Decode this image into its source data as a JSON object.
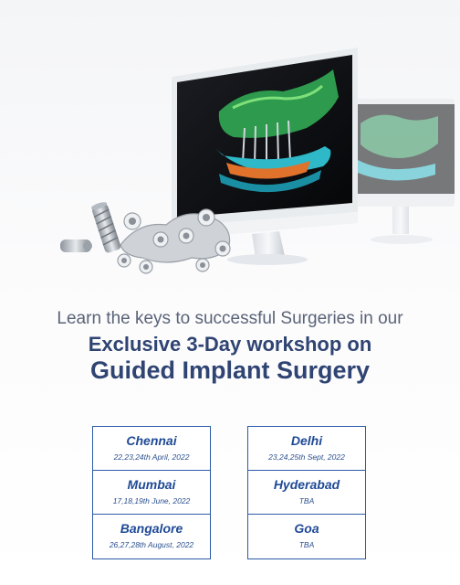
{
  "headline": {
    "line1": "Learn the keys to successful Surgeries in our",
    "line2": "Exclusive 3-Day workshop on",
    "line3": "Guided Implant Surgery"
  },
  "schedule": {
    "left": [
      {
        "city": "Chennai",
        "date": "22,23,24th April, 2022"
      },
      {
        "city": "Mumbai",
        "date": "17,18,19th June, 2022"
      },
      {
        "city": "Bangalore",
        "date": "26,27,28th August, 2022"
      }
    ],
    "right": [
      {
        "city": "Delhi",
        "date": "23,24,25th Sept, 2022"
      },
      {
        "city": "Hyderabad",
        "date": "TBA"
      },
      {
        "city": "Goa",
        "date": "TBA"
      }
    ]
  },
  "colors": {
    "headline": "#2f4472",
    "subheadline": "#5a6378",
    "table_border": "#2b5aa8",
    "table_text": "#1f4a96"
  }
}
